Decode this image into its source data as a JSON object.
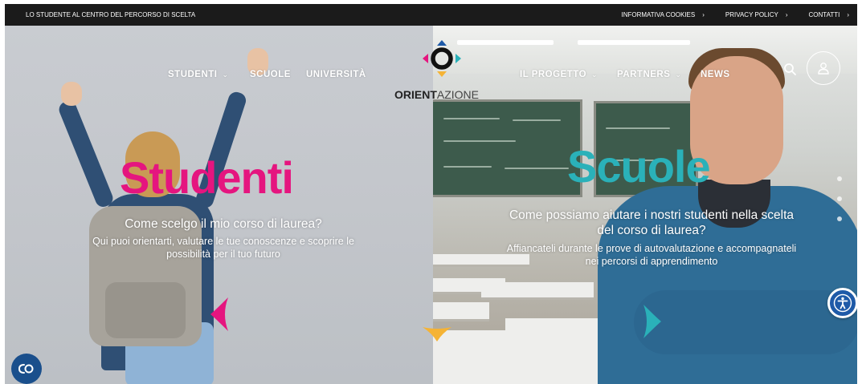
{
  "topbar": {
    "tagline": "LO STUDENTE AL CENTRO DEL PERCORSO DI SCELTA",
    "links": [
      {
        "label": "INFORMATIVA COOKIES",
        "chevron": "›"
      },
      {
        "label": "PRIVACY POLICY",
        "chevron": "›"
      },
      {
        "label": "CONTATTI",
        "chevron": "›"
      }
    ]
  },
  "nav": {
    "left": [
      {
        "label": "STUDENTI",
        "chevron": "⌄"
      },
      {
        "label": "SCUOLE"
      },
      {
        "label": "UNIVERSITÀ"
      }
    ],
    "right": [
      {
        "label": "IL PROGETTO",
        "chevron": "⌄"
      },
      {
        "label": "PARTNERS",
        "chevron": "⌄"
      },
      {
        "label": "NEWS"
      }
    ],
    "logo": {
      "bold": "ORIENT",
      "light": "AZIONE"
    }
  },
  "hero_left": {
    "headline": "Studenti",
    "question": "Come scelgo il mio corso di laurea?",
    "description_line1": "Qui puoi orientarti, valutare le tue conoscenze e scoprire le",
    "description_line2": "possibilità per il tuo futuro"
  },
  "hero_right": {
    "headline": "Scuole",
    "question_line1": "Come possiamo aiutare i nostri studenti nella scelta",
    "question_line2": "del corso di laurea?",
    "description_line1": "Affiancateli durante le prove di autovalutazione e accompagnateli",
    "description_line2": "nei percorsi di apprendimento"
  },
  "icons": {
    "search": "search-icon",
    "user": "user-icon",
    "accessibility": "accessibility-icon",
    "chat": "chat-icon"
  },
  "colors": {
    "pink": "#e5157f",
    "teal": "#2ab1b9",
    "yellow": "#f5b335",
    "topbar": "#1b1b1b",
    "accessibility": "#1e5aa8"
  }
}
